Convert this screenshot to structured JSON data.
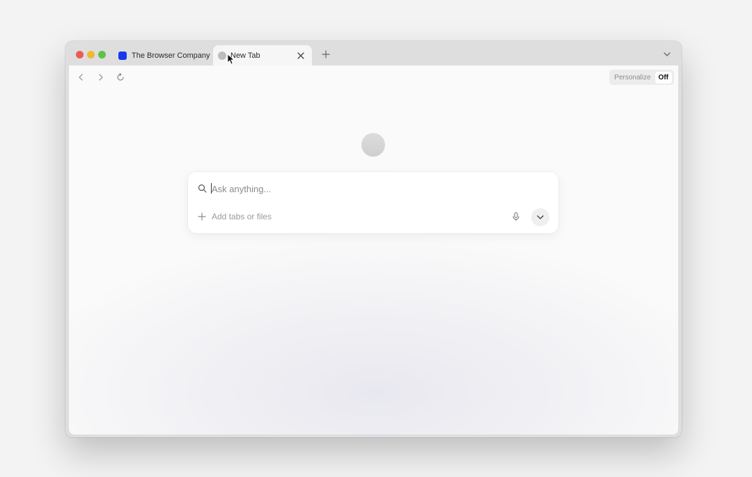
{
  "tabs": [
    {
      "title": "The Browser Company",
      "favicon": "the-browser-company-favicon",
      "active": false
    },
    {
      "title": "New Tab",
      "favicon": "globe-favicon",
      "active": true
    }
  ],
  "toolbar": {
    "personalize_label": "Personalize",
    "personalize_state": "Off"
  },
  "ask": {
    "placeholder": "Ask anything...",
    "add_label": "Add tabs or files"
  },
  "icons": {
    "search": "search-icon",
    "plus": "plus-icon",
    "mic": "microphone-icon",
    "dropdown": "chevron-down-icon",
    "back": "chevron-left-icon",
    "forward": "chevron-right-icon",
    "reload": "reload-icon",
    "close": "close-icon",
    "new_tab": "plus-icon"
  },
  "colors": {
    "traffic_red": "#ee5b55",
    "traffic_yellow": "#f1b931",
    "traffic_green": "#5dc245",
    "favicon_blue": "#1838ee"
  }
}
